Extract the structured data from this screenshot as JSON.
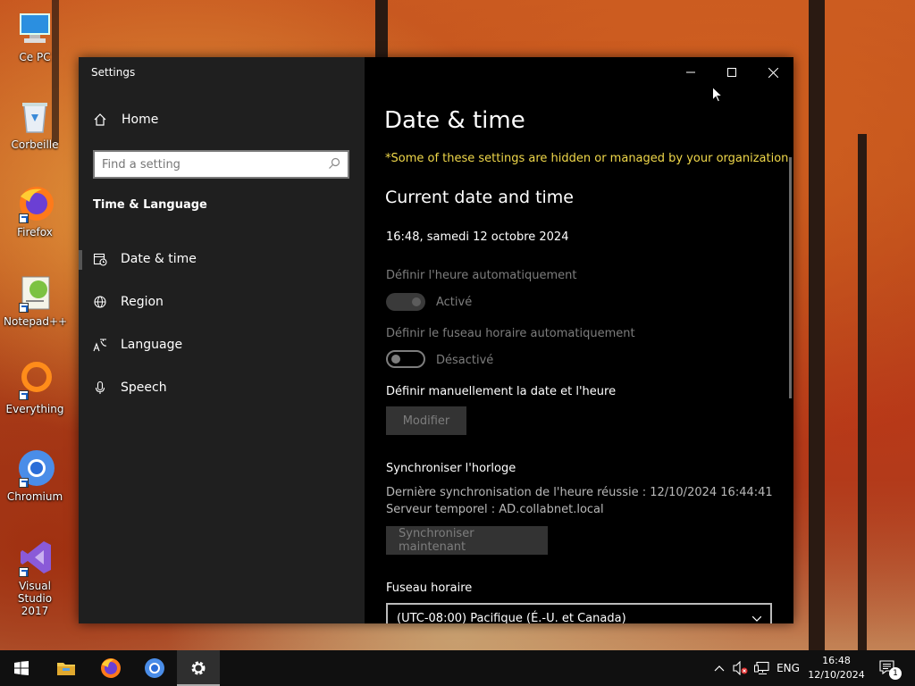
{
  "desktop": {
    "icons": [
      {
        "label": "Ce PC",
        "icon": "computer-icon"
      },
      {
        "label": "Corbeille",
        "icon": "recycle-bin-icon"
      },
      {
        "label": "Firefox",
        "icon": "firefox-icon"
      },
      {
        "label": "Notepad++",
        "icon": "notepad-plus-plus-icon"
      },
      {
        "label": "Everything",
        "icon": "everything-icon"
      },
      {
        "label": "Chromium",
        "icon": "chromium-icon"
      },
      {
        "label": "Visual Studio 2017",
        "icon": "visual-studio-icon"
      }
    ]
  },
  "window": {
    "title": "Settings",
    "controls": {
      "minimize": "minimize-icon",
      "maximize": "maximize-icon",
      "close": "close-icon"
    }
  },
  "sidebar": {
    "home_label": "Home",
    "search_placeholder": "Find a setting",
    "section_title": "Time & Language",
    "items": [
      {
        "label": "Date & time",
        "icon": "calendar-clock-icon",
        "active": true
      },
      {
        "label": "Region",
        "icon": "globe-icon",
        "active": false
      },
      {
        "label": "Language",
        "icon": "language-icon",
        "active": false
      },
      {
        "label": "Speech",
        "icon": "microphone-icon",
        "active": false
      }
    ]
  },
  "main": {
    "title": "Date & time",
    "org_notice": "*Some of these settings are hidden or managed by your organization.",
    "current_heading": "Current date and time",
    "current_value": "16:48, samedi 12 octobre 2024",
    "auto_time_label": "Définir l'heure automatiquement",
    "auto_time_state": "Activé",
    "auto_tz_label": "Définir le fuseau horaire automatiquement",
    "auto_tz_state": "Désactivé",
    "manual_label": "Définir manuellement la date et l'heure",
    "modify_button": "Modifier",
    "sync_heading": "Synchroniser l'horloge",
    "sync_last": "Dernière synchronisation de l'heure réussie : 12/10/2024 16:44:41",
    "sync_server": "Serveur temporel : AD.collabnet.local",
    "sync_button": "Synchroniser maintenant",
    "timezone_heading": "Fuseau horaire",
    "timezone_value": "(UTC-08:00) Pacifique (É.-U. et Canada)"
  },
  "taskbar": {
    "apps": [
      "start-icon",
      "file-explorer-icon",
      "firefox-icon",
      "chromium-icon",
      "settings-icon"
    ],
    "language": "ENG",
    "time": "16:48",
    "date": "12/10/2024",
    "notification_count": "1"
  },
  "colors": {
    "accent_warning": "#f0d84a",
    "window_bg": "#000000",
    "sidebar_bg": "#1f1f1f"
  }
}
